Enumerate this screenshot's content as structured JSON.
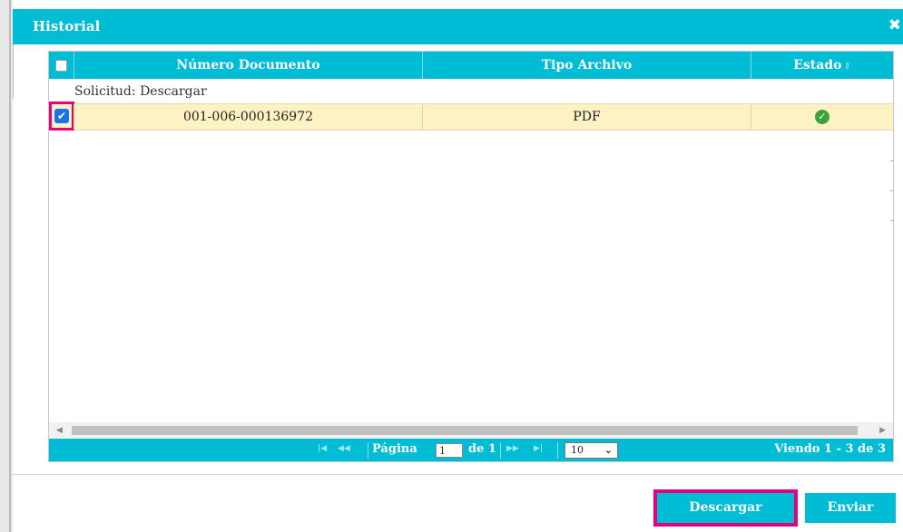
{
  "dialog": {
    "title": "Historial",
    "close_icon": "close-icon"
  },
  "grid": {
    "columns": [
      {
        "label": "",
        "type": "checkbox"
      },
      {
        "label": "Número Documento"
      },
      {
        "label": "Tipo Archivo"
      },
      {
        "label": "Estado",
        "sortable": true
      }
    ],
    "group_label": "Solicitud: Descargar",
    "rows": [
      {
        "checked": true,
        "numero_documento": "001-006-000136972",
        "tipo_archivo": "PDF",
        "estado_icon": "check-circle-icon"
      }
    ]
  },
  "pager": {
    "first_icon": "first-page-icon",
    "prev_icon": "prev-page-icon",
    "next_icon": "next-page-icon",
    "last_icon": "last-page-icon",
    "page_label": "Página",
    "page_value": "1",
    "of_label": "de 1",
    "rows_per_page": "10",
    "viewing": "Viendo 1 - 3 de 3"
  },
  "footer": {
    "descargar_label": "Descargar",
    "enviar_label": "Enviar"
  },
  "colors": {
    "accent": "#00bcd4",
    "highlight": "#e6007e",
    "selected_row": "#fdf2c3",
    "status_ok": "#3ba33a"
  }
}
